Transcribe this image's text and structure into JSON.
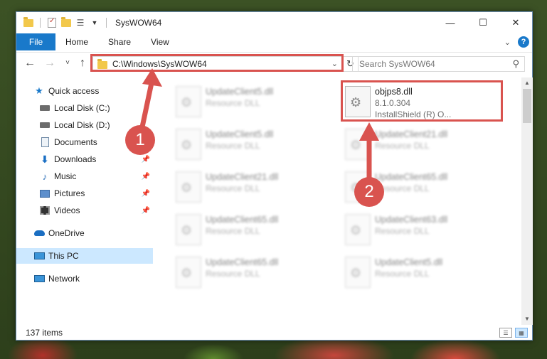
{
  "window": {
    "title": "SysWOW64",
    "controls": {
      "minimize": "—",
      "maximize": "☐",
      "close": "✕"
    }
  },
  "ribbon": {
    "file_tab": "File",
    "tabs": [
      "Home",
      "Share",
      "View"
    ],
    "help": "?"
  },
  "nav_toolbar": {
    "back": "←",
    "forward": "→",
    "recent": "˅",
    "up": "↑"
  },
  "address": {
    "path": "C:\\Windows\\SysWOW64",
    "dropdown": "⌄",
    "refresh": "↻"
  },
  "search": {
    "placeholder": "Search SysWOW64",
    "icon": "search-icon"
  },
  "sidebar": {
    "items": [
      {
        "label": "Quick access",
        "icon": "star-icon"
      },
      {
        "label": "Local Disk (C:)",
        "icon": "drive-icon"
      },
      {
        "label": "Local Disk (D:)",
        "icon": "drive-icon"
      },
      {
        "label": "Documents",
        "icon": "documents-icon",
        "pinned": true
      },
      {
        "label": "Downloads",
        "icon": "downloads-icon",
        "pinned": true
      },
      {
        "label": "Music",
        "icon": "music-icon",
        "pinned": true
      },
      {
        "label": "Pictures",
        "icon": "pictures-icon",
        "pinned": true
      },
      {
        "label": "Videos",
        "icon": "videos-icon",
        "pinned": true
      },
      {
        "label": "OneDrive",
        "icon": "onedrive-icon"
      },
      {
        "label": "This PC",
        "icon": "pc-icon",
        "selected": true
      },
      {
        "label": "Network",
        "icon": "network-icon"
      }
    ]
  },
  "files": {
    "highlighted": {
      "name": "objps8.dll",
      "version": "8.1.0.304",
      "company": "InstallShield (R) O..."
    },
    "others": [
      {
        "name": "UpdateClient5.dll",
        "type": "Resource DLL"
      },
      {
        "name": "UpdateClient5.dll",
        "type": "Resource DLL"
      },
      {
        "name": "UpdateClient21.dll",
        "type": "Resource DLL"
      },
      {
        "name": "UpdateClient21.dll",
        "type": "Resource DLL"
      },
      {
        "name": "UpdateClient65.dll",
        "type": "Resource DLL"
      },
      {
        "name": "UpdateClient65.dll",
        "type": "Resource DLL"
      },
      {
        "name": "UpdateClient63.dll",
        "type": "Resource DLL"
      },
      {
        "name": "UpdateClient65.dll",
        "type": "Resource DLL"
      },
      {
        "name": "UpdateClient5.dll",
        "type": "Resource DLL"
      }
    ]
  },
  "status": {
    "item_count": "137 items"
  },
  "annotations": {
    "step1": "1",
    "step2": "2",
    "color": "#d9534f"
  }
}
